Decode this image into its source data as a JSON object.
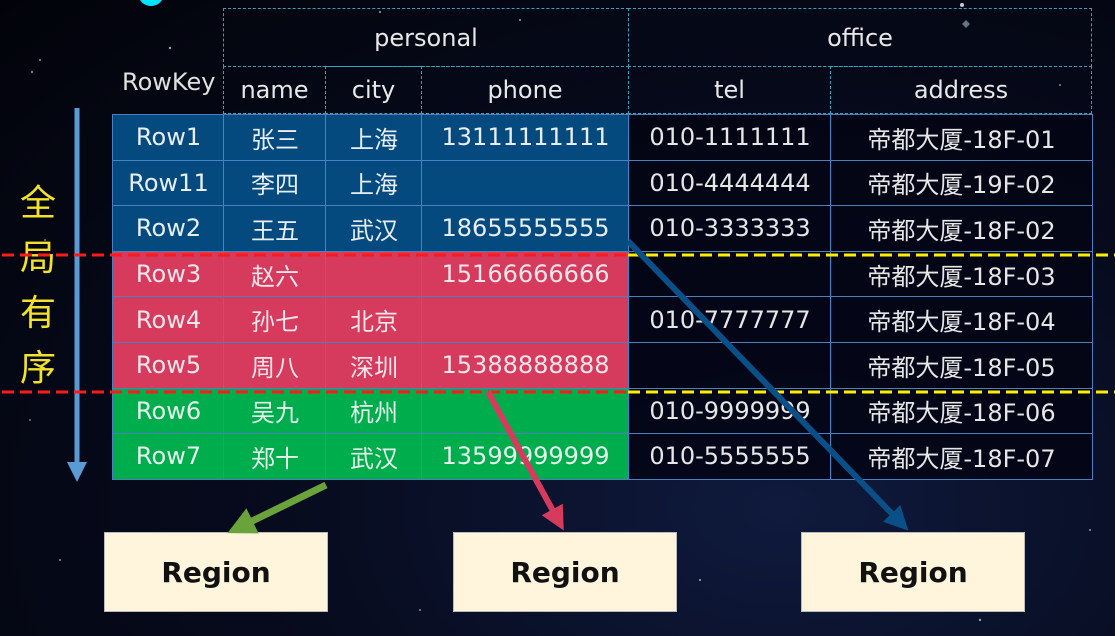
{
  "vertical_label": "全局有序",
  "header": {
    "rowkey": "RowKey",
    "families": [
      {
        "name": "personal",
        "columns": [
          "name",
          "city",
          "phone"
        ]
      },
      {
        "name": "office",
        "columns": [
          "tel",
          "address"
        ]
      }
    ]
  },
  "rows": [
    {
      "rowkey": "Row1",
      "name": "张三",
      "city": "上海",
      "phone": "13111111111",
      "tel": "010-1111111",
      "address": "帝都大厦-18F-01",
      "region": "blue"
    },
    {
      "rowkey": "Row11",
      "name": "李四",
      "city": "上海",
      "phone": "",
      "tel": "010-4444444",
      "address": "帝都大厦-19F-02",
      "region": "blue"
    },
    {
      "rowkey": "Row2",
      "name": "王五",
      "city": "武汉",
      "phone": "18655555555",
      "tel": "010-3333333",
      "address": "帝都大厦-18F-02",
      "region": "blue"
    },
    {
      "rowkey": "Row3",
      "name": "赵六",
      "city": "",
      "phone": "15166666666",
      "tel": "",
      "address": "帝都大厦-18F-03",
      "region": "red"
    },
    {
      "rowkey": "Row4",
      "name": "孙七",
      "city": "北京",
      "phone": "",
      "tel": "010-7777777",
      "address": "帝都大厦-18F-04",
      "region": "red"
    },
    {
      "rowkey": "Row5",
      "name": "周八",
      "city": "深圳",
      "phone": "15388888888",
      "tel": "",
      "address": "帝都大厦-18F-05",
      "region": "red"
    },
    {
      "rowkey": "Row6",
      "name": "吴九",
      "city": "杭州",
      "phone": "",
      "tel": "010-9999999",
      "address": "帝都大厦-18F-06",
      "region": "green"
    },
    {
      "rowkey": "Row7",
      "name": "郑十",
      "city": "武汉",
      "phone": "13599999999",
      "tel": "010-5555555",
      "address": "帝都大厦-18F-07",
      "region": "green"
    }
  ],
  "regions": [
    {
      "label": "Region",
      "color": "#6aa33c",
      "source": "green"
    },
    {
      "label": "Region",
      "color": "#d63b5d",
      "source": "red"
    },
    {
      "label": "Region",
      "color": "#0a4f87",
      "source": "blue"
    }
  ],
  "colors": {
    "blue_region": "#054a7f",
    "red_region": "#d63b5d",
    "green_region": "#00ad4c",
    "split_line_red": "#ff1a1a",
    "split_line_yellow": "#ffee00",
    "order_arrow": "#5b9bd5",
    "label_yellow": "#f2e22a",
    "region_box": "#fef5dc"
  }
}
